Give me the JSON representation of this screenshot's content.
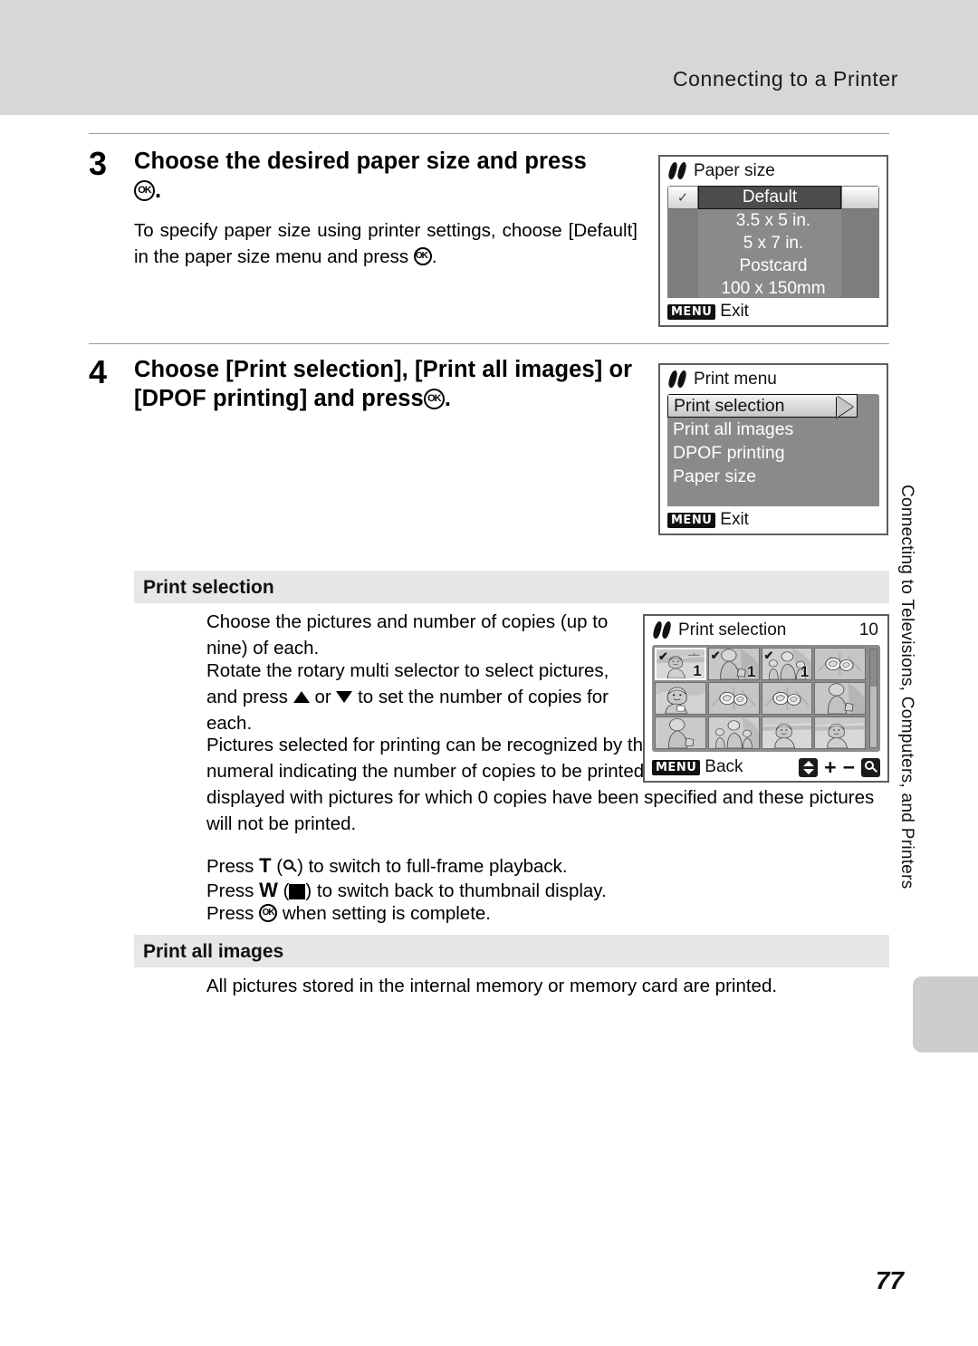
{
  "header": {
    "title": "Connecting to a Printer"
  },
  "side_tab": {
    "text": "Connecting to Televisions, Computers, and Printers"
  },
  "page": {
    "number": "77"
  },
  "steps": [
    {
      "number": "3",
      "heading_pre": "Choose the desired paper size and press",
      "heading_post": ".",
      "body_pre": "To specify paper size using printer settings, choose [Default] in the paper size menu and press",
      "body_post": "."
    },
    {
      "number": "4",
      "heading_pre": "Choose [Print selection], [Print all images] or [DPOF printing] and press",
      "heading_post": "."
    }
  ],
  "screens": {
    "paper_size": {
      "title": "Paper size",
      "icon": "pictbridge-icon",
      "selected": "Default",
      "check_mark": "✓",
      "items": [
        "3.5 x 5 in.",
        "5 x 7 in.",
        "Postcard",
        "100 x 150mm"
      ],
      "footer_button": "MENU",
      "footer_label": "Exit"
    },
    "print_menu": {
      "title": "Print menu",
      "icon": "pictbridge-icon",
      "items": [
        {
          "label": "Print selection",
          "selected": true
        },
        {
          "label": "Print all images",
          "selected": false
        },
        {
          "label": "DPOF printing",
          "selected": false
        },
        {
          "label": "Paper size",
          "selected": false
        }
      ],
      "footer_button": "MENU",
      "footer_label": "Exit"
    },
    "print_selection": {
      "title": "Print selection",
      "icon": "pictbridge-icon",
      "count": "10",
      "footer_button": "MENU",
      "footer_label": "Back",
      "footer_icons": [
        "updown-icon",
        "plus-icon",
        "minus-icon",
        "zoom-icon"
      ],
      "thumbnails": [
        {
          "id": 1,
          "art": "woman-beach",
          "checked": true,
          "copies": "1",
          "selected": true
        },
        {
          "id": 2,
          "art": "woman-bag",
          "checked": true,
          "copies": "1",
          "selected": false
        },
        {
          "id": 3,
          "art": "family",
          "checked": true,
          "copies": "1",
          "selected": false
        },
        {
          "id": 4,
          "art": "flowers",
          "checked": false,
          "copies": "",
          "selected": false
        },
        {
          "id": 5,
          "art": "portrait",
          "checked": false,
          "copies": "",
          "selected": false
        },
        {
          "id": 6,
          "art": "flowers",
          "checked": false,
          "copies": "",
          "selected": false
        },
        {
          "id": 7,
          "art": "flowers",
          "checked": false,
          "copies": "",
          "selected": false
        },
        {
          "id": 8,
          "art": "woman-bag",
          "checked": false,
          "copies": "",
          "selected": false
        },
        {
          "id": 9,
          "art": "woman-bag",
          "checked": false,
          "copies": "",
          "selected": false
        },
        {
          "id": 10,
          "art": "family",
          "checked": false,
          "copies": "",
          "selected": false
        },
        {
          "id": 11,
          "art": "woman-beach",
          "checked": false,
          "copies": "",
          "selected": false
        },
        {
          "id": 12,
          "art": "woman-beach",
          "checked": false,
          "copies": "",
          "selected": false
        }
      ]
    }
  },
  "sections": [
    {
      "heading": "Print selection",
      "lines": {
        "l1": "Choose the pictures and number of copies (up to nine) of each.",
        "l2_pre": "Rotate the rotary multi selector to select pictures, and press",
        "l2_mid": "or",
        "l2_post": "to set the number of copies for each.",
        "l3_pre": "Pictures selected for printing can be recognized by the check mark (",
        "l3_post": ") and the numeral indicating the number of copies to be printed. A check mark is not displayed with pictures for which 0 copies have been specified and these pictures will not be printed.",
        "l4_pre": "Press",
        "l4_key": "T",
        "l4_post": ") to switch to full-frame playback.",
        "l5_pre": "Press",
        "l5_key": "W",
        "l5_post": ") to switch back to thumbnail display.",
        "l6_pre": "Press",
        "l6_post": "when setting is complete."
      }
    },
    {
      "heading": "Print all images",
      "body": "All pictures stored in the internal memory or memory card are printed."
    }
  ]
}
